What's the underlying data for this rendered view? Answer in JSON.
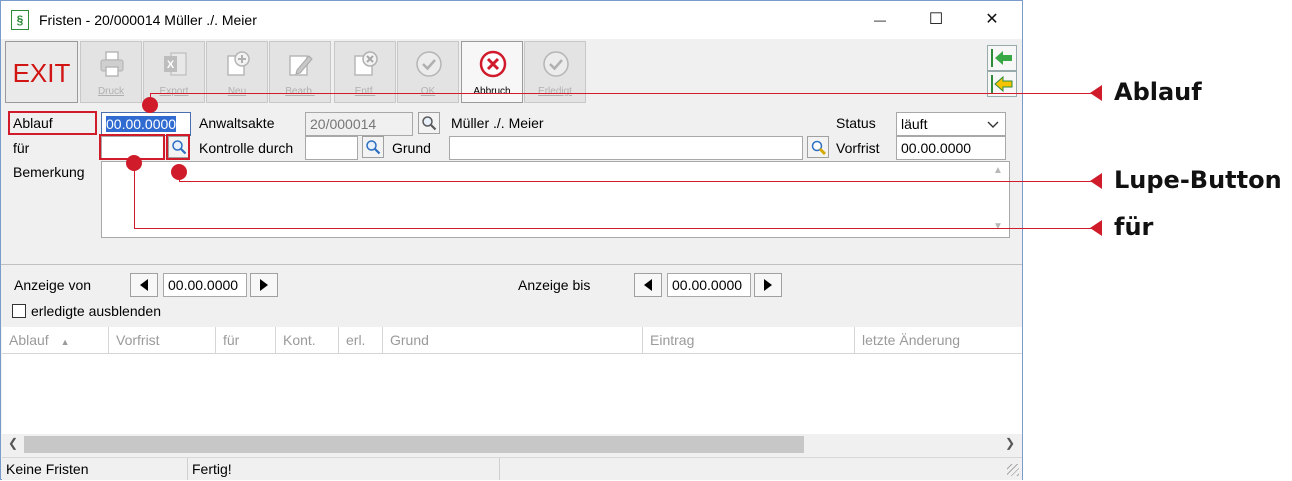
{
  "window": {
    "title": "Fristen - 20/000014 Müller ./. Meier",
    "app_icon": "§",
    "controls": {
      "minimize": "—",
      "maximize": "☐",
      "close": "✕"
    }
  },
  "toolbar": {
    "exit_label": "EXIT",
    "buttons": [
      {
        "label": "Druck",
        "icon": "printer-icon",
        "enabled": false
      },
      {
        "label": "Export",
        "icon": "excel-icon",
        "enabled": false
      },
      {
        "label": "Neu",
        "icon": "new-document-icon",
        "enabled": false
      },
      {
        "label": "Bearb.",
        "icon": "pencil-icon",
        "enabled": false
      },
      {
        "label": "Entf.",
        "icon": "delete-icon",
        "enabled": false
      },
      {
        "label": "OK",
        "icon": "checkmark-icon",
        "enabled": false
      },
      {
        "label": "Abbruch",
        "icon": "cancel-icon",
        "enabled": true
      },
      {
        "label": "Erledigt",
        "icon": "checkmark-icon",
        "enabled": false
      }
    ]
  },
  "form": {
    "ablauf_label": "Ablauf",
    "ablauf_value": "00.00.0000",
    "anwaltsakte_label": "Anwaltsakte",
    "anwaltsakte_value": "20/000014",
    "parties": "Müller ./. Meier",
    "status_label": "Status",
    "status_value": "läuft",
    "fuer_label": "für",
    "fuer_value": "",
    "kontrolle_label": "Kontrolle durch",
    "kontrolle_value": "",
    "grund_label": "Grund",
    "grund_value": "",
    "vorfrist_label": "Vorfrist",
    "vorfrist_value": "00.00.0000",
    "bemerkung_label": "Bemerkung",
    "bemerkung_value": ""
  },
  "filter": {
    "anzeige_von_label": "Anzeige von",
    "anzeige_von_value": "00.00.0000",
    "anzeige_bis_label": "Anzeige bis",
    "anzeige_bis_value": "00.00.0000",
    "erledigte_label": "erledigte ausblenden",
    "erledigte_checked": false
  },
  "grid": {
    "columns": [
      "Ablauf",
      "Vorfrist",
      "für",
      "Kont.",
      "erl.",
      "Grund",
      "Eintrag",
      "letzte Änderung"
    ],
    "sort_indicator": "▲",
    "rows": []
  },
  "statusbar": {
    "left": "Keine Fristen",
    "middle": "Fertig!"
  },
  "annotations": {
    "ablauf": "Ablauf",
    "lupe": "Lupe-Button",
    "fuer": "für",
    "color": "#d01c2a"
  }
}
